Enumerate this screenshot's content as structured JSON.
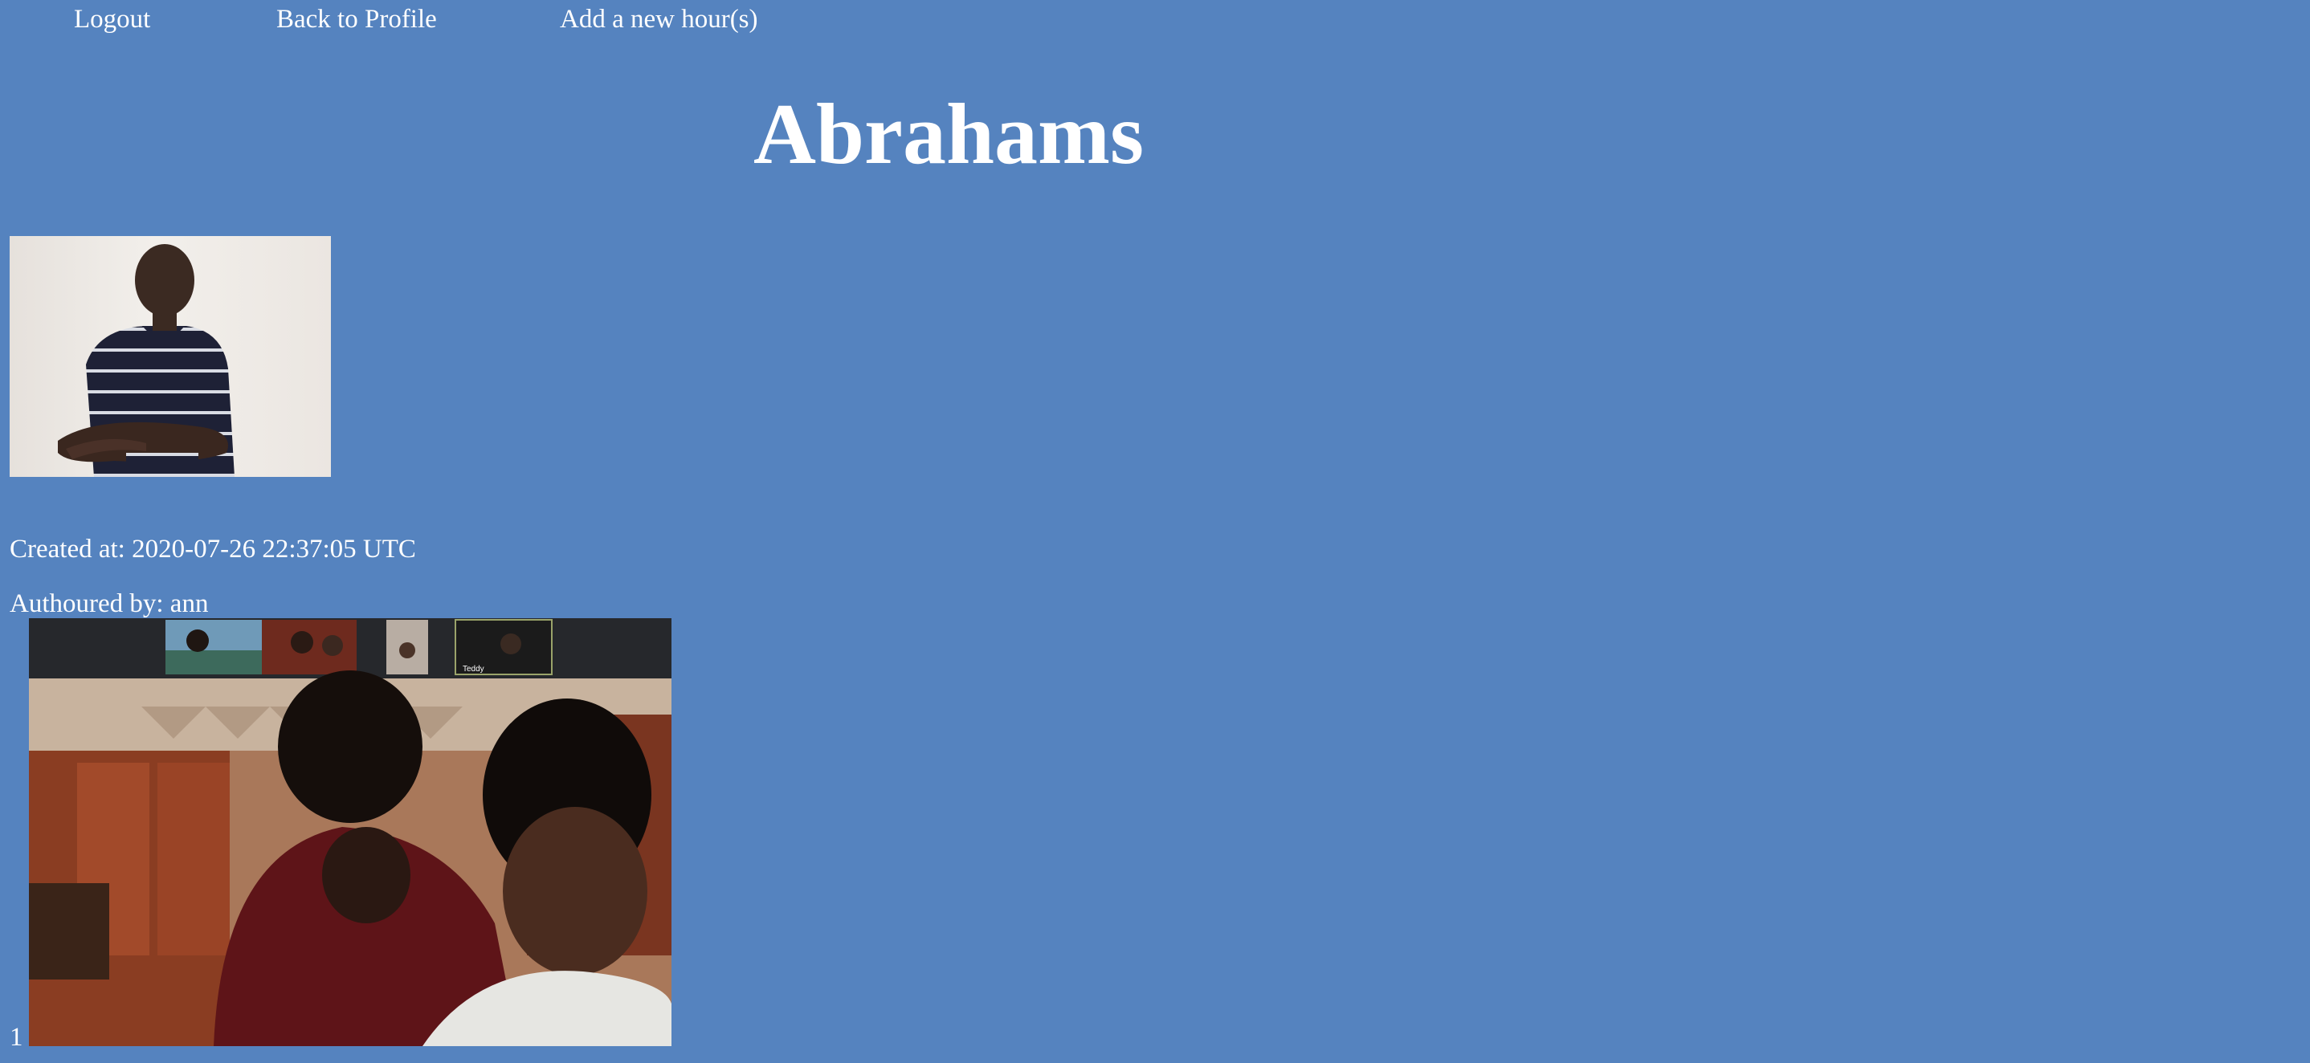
{
  "nav": {
    "logout": "Logout",
    "back_to_profile": "Back to Profile",
    "add_hours": "Add a new hour(s)"
  },
  "title": "Abrahams",
  "meta": {
    "created": "Created at: 2020-07-26 22:37:05 UTC",
    "authored": "Authoured by: ann"
  },
  "entries": [
    {
      "index": "1",
      "thumbnail_label": "Teddy"
    }
  ],
  "colors": {
    "background": "#5583bf",
    "text": "#ffffff"
  }
}
